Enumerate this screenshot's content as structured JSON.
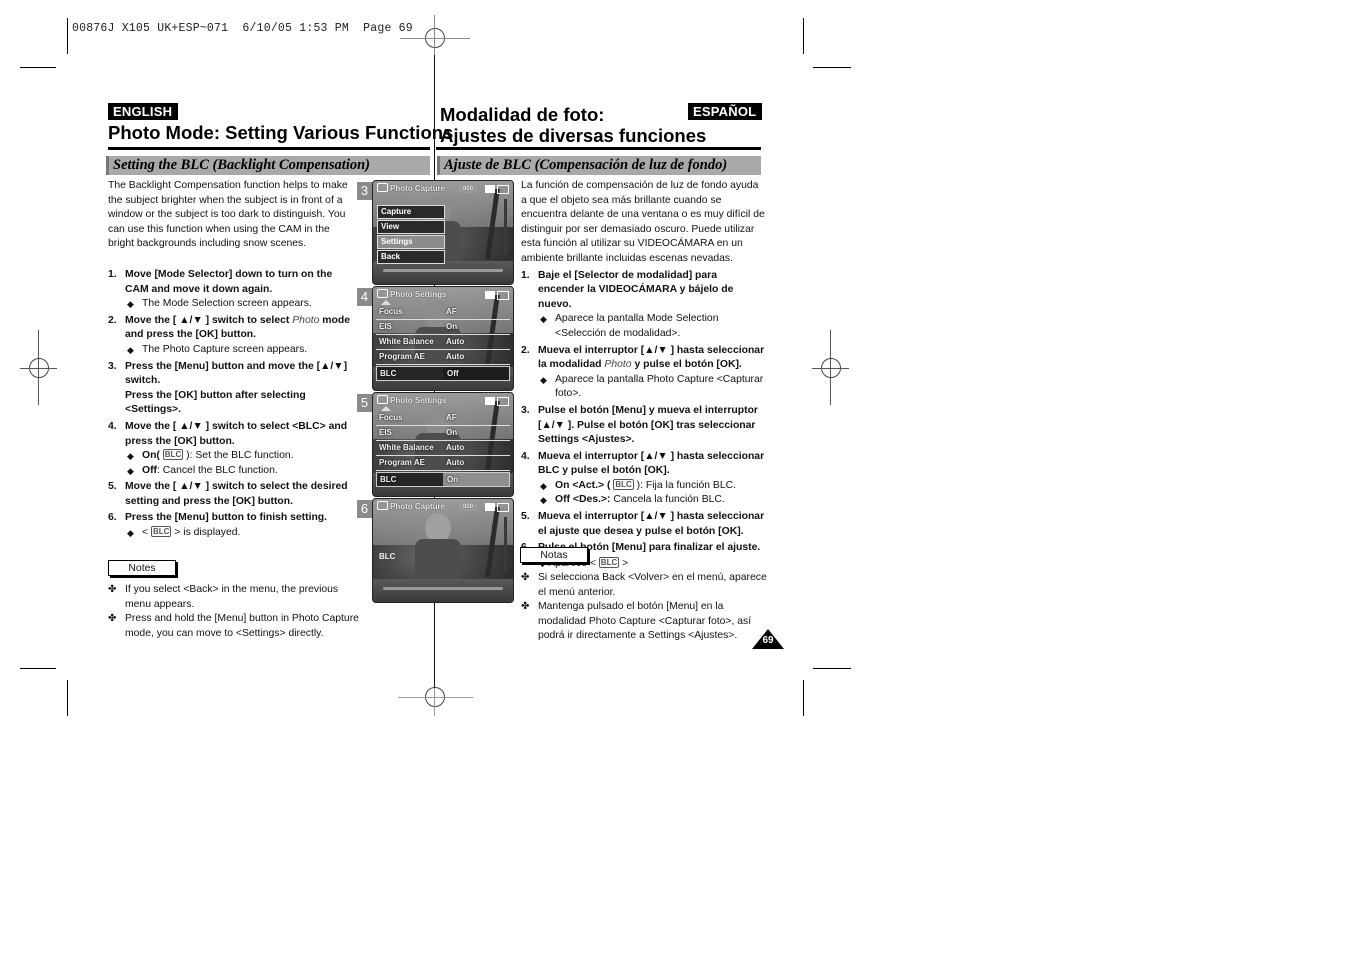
{
  "slug": "00876J X105 UK+ESP~071  6/10/05 1:53 PM  Page 69",
  "page_number": "69",
  "english": {
    "lang_label": "ENGLISH",
    "title": "Photo Mode: Setting Various Functions",
    "section": "Setting the BLC (Backlight Compensation)",
    "intro": "The Backlight Compensation function helps to make the subject brighter when the subject is in front of a window or the subject is too dark to distinguish. You can use this function when using the CAM in the bright backgrounds including snow scenes.",
    "steps": [
      {
        "num": "1.",
        "text": "Move [Mode Selector] down to turn on the CAM and move it down again.",
        "bullets": [
          "The Mode Selection screen appears."
        ]
      },
      {
        "num": "2.",
        "text_a": "Move the [ ▲/▼ ] switch to select ",
        "text_italic": "Photo",
        "text_b": " mode and press the [OK] button.",
        "bullets": [
          "The Photo Capture screen appears."
        ]
      },
      {
        "num": "3.",
        "text": "Press the [Menu] button and move the [▲/▼] switch.",
        "text2": "Press the [OK] button after selecting <Settings>."
      },
      {
        "num": "4.",
        "text": "Move the [ ▲/▼ ] switch to select <BLC> and press the [OK] button.",
        "on_label": "On(",
        "on_glyph": "BLC",
        "on_text": " ): Set the BLC function.",
        "off_label": "Off",
        "off_text": ": Cancel the BLC function."
      },
      {
        "num": "5.",
        "text": "Move the [ ▲/▼ ] switch to select the desired setting and press the [OK] button."
      },
      {
        "num": "6.",
        "text": "Press the [Menu] button to finish setting.",
        "disp_a": "< ",
        "disp_glyph": "BLC",
        "disp_b": " > is displayed."
      }
    ],
    "notes_label": "Notes",
    "notes": [
      "If you select <Back> in the menu, the previous menu appears.",
      "Press and hold the [Menu] button in Photo Capture mode, you can move to <Settings> directly."
    ]
  },
  "spanish": {
    "lang_label": "ESPAÑOL",
    "title_line1": "Modalidad de foto:",
    "title_line2": "Ajustes de diversas funciones",
    "section": "Ajuste de BLC (Compensación de luz de fondo)",
    "intro": "La función de compensación de luz de fondo ayuda a que el objeto sea más brillante cuando se encuentra delante de una ventana o es muy difícil de distinguir por ser demasiado oscuro. Puede utilizar esta función al utilizar su VIDEOCÁMARA en un ambiente brillante incluidas escenas nevadas.",
    "steps": [
      {
        "num": "1.",
        "text": "Baje el [Selector de modalidad] para encender la VIDEOCÁMARA y bájelo de nuevo.",
        "bullets": [
          "Aparece la pantalla Mode Selection <Selección de modalidad>."
        ]
      },
      {
        "num": "2.",
        "text_a": "Mueva el interruptor [▲/▼ ] hasta seleccionar la modalidad ",
        "text_italic": "Photo",
        "text_b": " y pulse el botón [OK].",
        "bullets": [
          "Aparece la pantalla Photo Capture <Capturar foto>."
        ]
      },
      {
        "num": "3.",
        "text": "Pulse el botón [Menu] y mueva el interruptor [▲/▼ ]. Pulse el botón [OK] tras seleccionar Settings <Ajustes>."
      },
      {
        "num": "4.",
        "text": "Mueva el interruptor [▲/▼ ] hasta seleccionar BLC y pulse el botón [OK].",
        "on_label": "On <Act.> (",
        "on_glyph": "BLC",
        "on_text": " ): Fija la función BLC.",
        "off_label": "Off <Des.>:",
        "off_text": " Cancela la función BLC."
      },
      {
        "num": "5.",
        "text": "Mueva el interruptor [▲/▼ ] hasta seleccionar el ajuste que desea y pulse el botón [OK]."
      },
      {
        "num": "6.",
        "text": "Pulse el botón [Menu] para finalizar el ajuste.",
        "disp_a": "Aparece < ",
        "disp_glyph": "BLC",
        "disp_b": " >"
      }
    ],
    "notes_label": "Notas",
    "notes": [
      "Si selecciona Back <Volver> en el menú, aparece el menú anterior.",
      "Mantenga pulsado el botón [Menu] en la modalidad Photo Capture <Capturar foto>, así podrá ir directamente a Settings <Ajustes>."
    ]
  },
  "screens": [
    {
      "num": "3",
      "header": "Photo Capture",
      "res": "800",
      "menu": [
        {
          "label": "Capture",
          "selected": false
        },
        {
          "label": "View",
          "selected": false
        },
        {
          "label": "Settings",
          "selected": true
        },
        {
          "label": "Back",
          "selected": false
        }
      ]
    },
    {
      "num": "4",
      "header": "Photo Settings",
      "rows": [
        {
          "k": "Focus",
          "v": "AF"
        },
        {
          "k": "EIS",
          "v": "On"
        },
        {
          "k": "White Balance",
          "v": "Auto"
        },
        {
          "k": "Program AE",
          "v": "Auto"
        }
      ],
      "blc": {
        "k": "BLC",
        "v": "Off"
      }
    },
    {
      "num": "5",
      "header": "Photo Settings",
      "rows": [
        {
          "k": "Focus",
          "v": "AF"
        },
        {
          "k": "EIS",
          "v": "On"
        },
        {
          "k": "White Balance",
          "v": "Auto"
        },
        {
          "k": "Program AE",
          "v": "Auto"
        }
      ],
      "blc": {
        "k": "BLC",
        "v": "On"
      }
    },
    {
      "num": "6",
      "header": "Photo Capture",
      "res": "800",
      "osd_indicator": "BLC"
    }
  ],
  "icons": {
    "bullet": "◆",
    "note": "✤",
    "arrow_up_down": "▲/▼"
  }
}
